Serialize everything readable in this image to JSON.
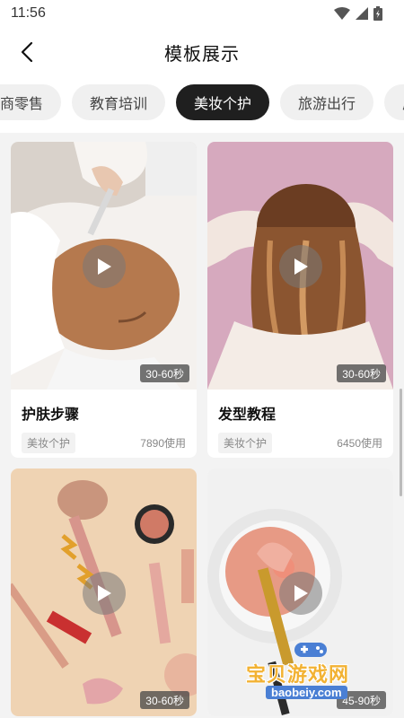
{
  "status_bar": {
    "time": "11:56"
  },
  "header": {
    "title": "模板展示"
  },
  "tabs": [
    {
      "label": "商零售",
      "active": false
    },
    {
      "label": "教育培训",
      "active": false
    },
    {
      "label": "美妆个护",
      "active": true
    },
    {
      "label": "旅游出行",
      "active": false
    },
    {
      "label": "房",
      "active": false
    }
  ],
  "cards": [
    {
      "title": "护肤步骤",
      "tag": "美妆个护",
      "uses": "7890使用",
      "duration": "30-60秒"
    },
    {
      "title": "发型教程",
      "tag": "美妆个护",
      "uses": "6450使用",
      "duration": "30-60秒"
    },
    {
      "title": "",
      "tag": "",
      "uses": "",
      "duration": "30-60秒"
    },
    {
      "title": "",
      "tag": "",
      "uses": "",
      "duration": "45-90秒"
    }
  ],
  "watermark": {
    "text": "宝贝游戏网",
    "domain": "baobeiy.com"
  }
}
